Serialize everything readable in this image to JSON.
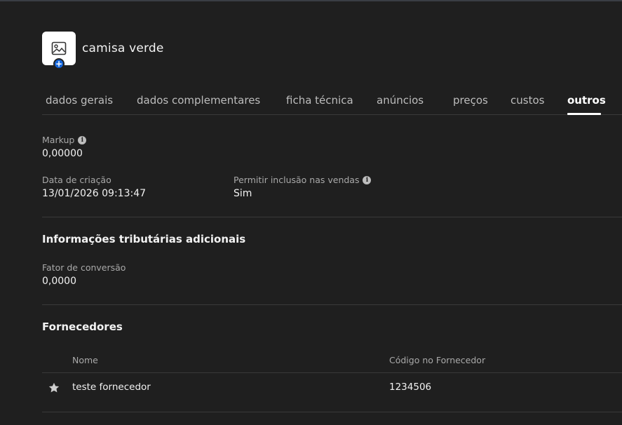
{
  "product": {
    "title": "camisa verde",
    "thumbnail_icon": "image-icon",
    "add_icon": "plus-icon",
    "add_symbol": "+"
  },
  "tabs": [
    {
      "label": "dados gerais",
      "active": false
    },
    {
      "label": "dados complementares",
      "active": false
    },
    {
      "label": "ficha técnica",
      "active": false
    },
    {
      "label": "anúncios",
      "active": false
    },
    {
      "label": "preços",
      "active": false
    },
    {
      "label": "custos",
      "active": false
    },
    {
      "label": "outros",
      "active": true
    }
  ],
  "fields": {
    "markup": {
      "label": "Markup",
      "value": "0,00000"
    },
    "creation_date": {
      "label": "Data de criação",
      "value": "13/01/2026 09:13:47"
    },
    "allow_sales": {
      "label": "Permitir inclusão nas vendas",
      "value": "Sim"
    }
  },
  "info_symbol": "i",
  "tax_section": {
    "title": "Informações tributárias adicionais",
    "conversion_factor": {
      "label": "Fator de conversão",
      "value": "0,0000"
    }
  },
  "suppliers": {
    "title": "Fornecedores",
    "columns": [
      "Nome",
      "Código no Fornecedor"
    ],
    "rows": [
      {
        "name": "teste fornecedor",
        "code": "1234506",
        "favorite_icon": "star-icon"
      }
    ]
  },
  "colors": {
    "background": "#1f1f1f",
    "accent": "#1565d8",
    "text": "#f2f2f2",
    "muted": "#a9a9a9"
  }
}
